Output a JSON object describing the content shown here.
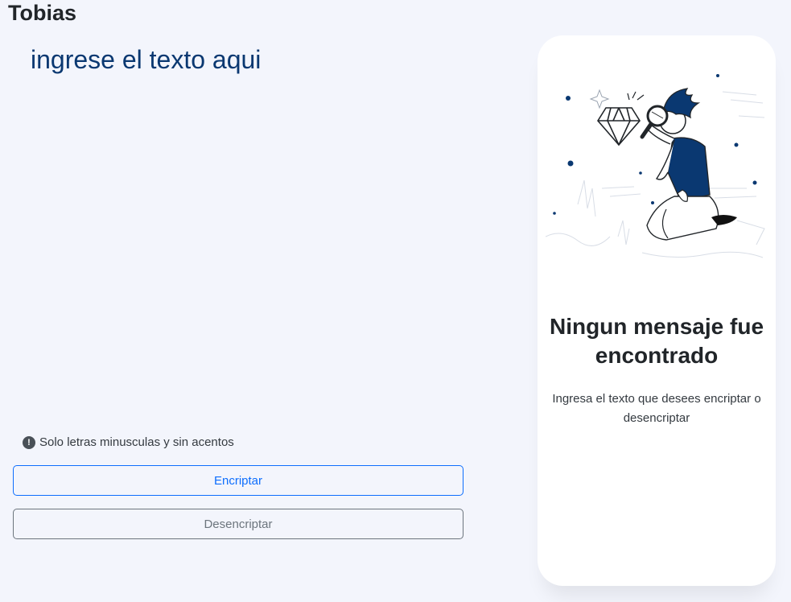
{
  "header": {
    "logo_text": "Tobias"
  },
  "editor": {
    "placeholder": "ingrese el texto aqui",
    "value": ""
  },
  "hint": {
    "icon": "exclamation-circle-icon",
    "text": "Solo letras minusculas y sin acentos"
  },
  "actions": {
    "encrypt_label": "Encriptar",
    "decrypt_label": "Desencriptar"
  },
  "output_panel": {
    "illustration": "person-with-magnifying-glass-illustration",
    "title": "Ningun mensaje fue encontrado",
    "description": "Ingresa el texto que desees encriptar o desencriptar"
  },
  "colors": {
    "background": "#f3f5fc",
    "accent": "#0a3871",
    "primary_button": "#0d6efd",
    "secondary_button": "#6c757d",
    "panel": "#ffffff"
  }
}
